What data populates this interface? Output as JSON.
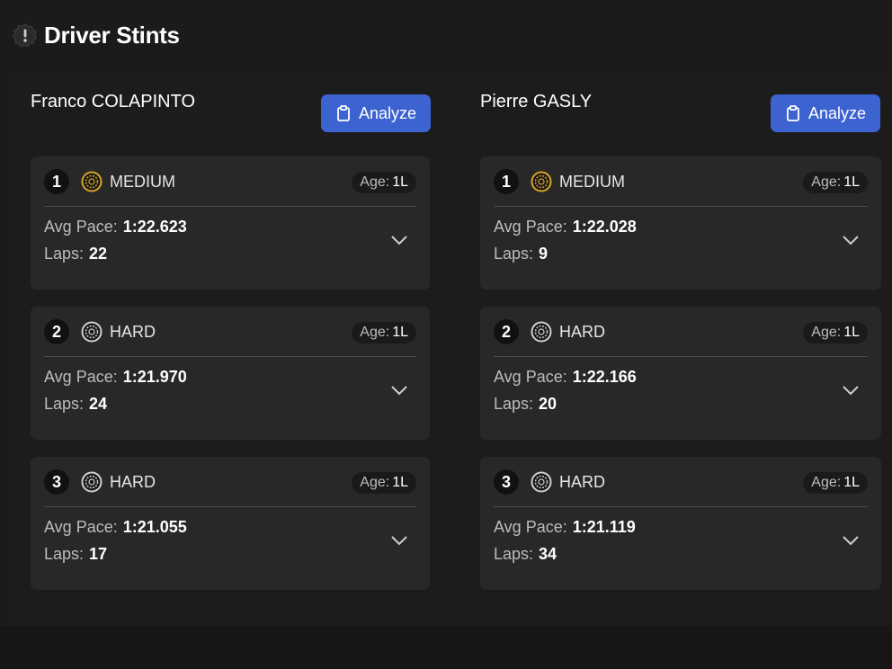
{
  "header": {
    "title": "Driver Stints",
    "icon": "alert-badge-icon"
  },
  "ui": {
    "analyze_label": "Analyze",
    "age_label": "Age:",
    "pace_label": "Avg Pace:",
    "laps_label": "Laps:"
  },
  "colors": {
    "accent": "#3d63d1",
    "medium_tyre": "#d9a520",
    "hard_tyre": "#cfcfcf",
    "card_bg": "#282828",
    "page_bg": "#1b1b1b"
  },
  "drivers": [
    {
      "name": "Franco COLAPINTO",
      "stints": [
        {
          "num": "1",
          "compound": "MEDIUM",
          "age": "1L",
          "pace": "1:22.623",
          "laps": "22"
        },
        {
          "num": "2",
          "compound": "HARD",
          "age": "1L",
          "pace": "1:21.970",
          "laps": "24"
        },
        {
          "num": "3",
          "compound": "HARD",
          "age": "1L",
          "pace": "1:21.055",
          "laps": "17"
        }
      ]
    },
    {
      "name": "Pierre GASLY",
      "stints": [
        {
          "num": "1",
          "compound": "MEDIUM",
          "age": "1L",
          "pace": "1:22.028",
          "laps": "9"
        },
        {
          "num": "2",
          "compound": "HARD",
          "age": "1L",
          "pace": "1:22.166",
          "laps": "20"
        },
        {
          "num": "3",
          "compound": "HARD",
          "age": "1L",
          "pace": "1:21.119",
          "laps": "34"
        }
      ]
    }
  ]
}
